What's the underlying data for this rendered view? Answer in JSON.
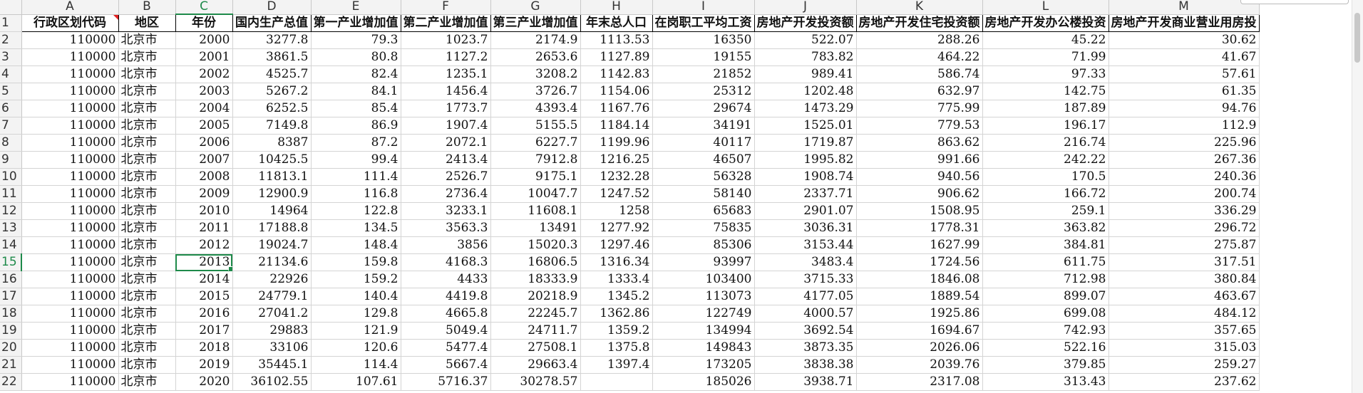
{
  "sheet": {
    "columns": [
      "A",
      "B",
      "C",
      "D",
      "E",
      "F",
      "G",
      "H",
      "I",
      "J",
      "K",
      "L",
      "M"
    ],
    "active_column": "C",
    "active_row": "15",
    "header_row": {
      "row_number": "1",
      "cells": [
        "行政区划代码",
        "地区",
        "年份",
        "国内生产总值",
        "第一产业增加值",
        "第二产业增加值",
        "第三产业增加值",
        "年末总人口",
        "在岗职工平均工资",
        "房地产开发投资额",
        "房地产开发住宅投资额",
        "房地产开发办公楼投资",
        "房地产开发商业营业用房投"
      ]
    },
    "rows": [
      {
        "n": "2",
        "cells": [
          "110000",
          "北京市",
          "2000",
          "3277.8",
          "79.3",
          "1023.7",
          "2174.9",
          "1113.53",
          "16350",
          "522.07",
          "288.26",
          "45.22",
          "30.62"
        ]
      },
      {
        "n": "3",
        "cells": [
          "110000",
          "北京市",
          "2001",
          "3861.5",
          "80.8",
          "1127.2",
          "2653.6",
          "1127.89",
          "19155",
          "783.82",
          "464.22",
          "71.99",
          "41.67"
        ]
      },
      {
        "n": "4",
        "cells": [
          "110000",
          "北京市",
          "2002",
          "4525.7",
          "82.4",
          "1235.1",
          "3208.2",
          "1142.83",
          "21852",
          "989.41",
          "586.74",
          "97.33",
          "57.61"
        ]
      },
      {
        "n": "5",
        "cells": [
          "110000",
          "北京市",
          "2003",
          "5267.2",
          "84.1",
          "1456.4",
          "3726.7",
          "1154.06",
          "25312",
          "1202.48",
          "632.97",
          "142.75",
          "61.35"
        ]
      },
      {
        "n": "6",
        "cells": [
          "110000",
          "北京市",
          "2004",
          "6252.5",
          "85.4",
          "1773.7",
          "4393.4",
          "1167.76",
          "29674",
          "1473.29",
          "775.99",
          "187.89",
          "94.76"
        ]
      },
      {
        "n": "7",
        "cells": [
          "110000",
          "北京市",
          "2005",
          "7149.8",
          "86.9",
          "1907.4",
          "5155.5",
          "1184.14",
          "34191",
          "1525.01",
          "779.53",
          "196.17",
          "112.9"
        ]
      },
      {
        "n": "8",
        "cells": [
          "110000",
          "北京市",
          "2006",
          "8387",
          "87.2",
          "2072.1",
          "6227.7",
          "1199.96",
          "40117",
          "1719.87",
          "863.62",
          "216.74",
          "225.96"
        ]
      },
      {
        "n": "9",
        "cells": [
          "110000",
          "北京市",
          "2007",
          "10425.5",
          "99.4",
          "2413.4",
          "7912.8",
          "1216.25",
          "46507",
          "1995.82",
          "991.66",
          "242.22",
          "267.36"
        ]
      },
      {
        "n": "10",
        "cells": [
          "110000",
          "北京市",
          "2008",
          "11813.1",
          "111.4",
          "2526.7",
          "9175.1",
          "1232.28",
          "56328",
          "1908.74",
          "940.56",
          "170.5",
          "240.36"
        ]
      },
      {
        "n": "11",
        "cells": [
          "110000",
          "北京市",
          "2009",
          "12900.9",
          "116.8",
          "2736.4",
          "10047.7",
          "1247.52",
          "58140",
          "2337.71",
          "906.62",
          "166.72",
          "200.74"
        ]
      },
      {
        "n": "12",
        "cells": [
          "110000",
          "北京市",
          "2010",
          "14964",
          "122.8",
          "3233.1",
          "11608.1",
          "1258",
          "65683",
          "2901.07",
          "1508.95",
          "259.1",
          "336.29"
        ]
      },
      {
        "n": "13",
        "cells": [
          "110000",
          "北京市",
          "2011",
          "17188.8",
          "134.5",
          "3563.3",
          "13491",
          "1277.92",
          "75835",
          "3036.31",
          "1778.31",
          "363.82",
          "296.72"
        ]
      },
      {
        "n": "14",
        "cells": [
          "110000",
          "北京市",
          "2012",
          "19024.7",
          "148.4",
          "3856",
          "15020.3",
          "1297.46",
          "85306",
          "3153.44",
          "1627.99",
          "384.81",
          "275.87"
        ]
      },
      {
        "n": "15",
        "cells": [
          "110000",
          "北京市",
          "2013",
          "21134.6",
          "159.8",
          "4168.3",
          "16806.5",
          "1316.34",
          "93997",
          "3483.4",
          "1724.56",
          "611.75",
          "317.51"
        ]
      },
      {
        "n": "16",
        "cells": [
          "110000",
          "北京市",
          "2014",
          "22926",
          "159.2",
          "4433",
          "18333.9",
          "1333.4",
          "103400",
          "3715.33",
          "1846.08",
          "712.98",
          "380.84"
        ]
      },
      {
        "n": "17",
        "cells": [
          "110000",
          "北京市",
          "2015",
          "24779.1",
          "140.4",
          "4419.8",
          "20218.9",
          "1345.2",
          "113073",
          "4177.05",
          "1889.54",
          "899.07",
          "463.67"
        ]
      },
      {
        "n": "18",
        "cells": [
          "110000",
          "北京市",
          "2016",
          "27041.2",
          "129.8",
          "4665.8",
          "22245.7",
          "1362.86",
          "122749",
          "4000.57",
          "1925.86",
          "699.08",
          "484.12"
        ]
      },
      {
        "n": "19",
        "cells": [
          "110000",
          "北京市",
          "2017",
          "29883",
          "121.9",
          "5049.4",
          "24711.7",
          "1359.2",
          "134994",
          "3692.54",
          "1694.67",
          "742.93",
          "357.65"
        ]
      },
      {
        "n": "20",
        "cells": [
          "110000",
          "北京市",
          "2018",
          "33106",
          "120.6",
          "5477.4",
          "27508.1",
          "1375.8",
          "149843",
          "3873.35",
          "2026.06",
          "522.16",
          "315.03"
        ]
      },
      {
        "n": "21",
        "cells": [
          "110000",
          "北京市",
          "2019",
          "35445.1",
          "114.4",
          "5667.4",
          "29663.4",
          "1397.4",
          "173205",
          "3838.38",
          "2039.76",
          "379.85",
          "259.27"
        ]
      },
      {
        "n": "22",
        "cells": [
          "110000",
          "北京市",
          "2020",
          "36102.55",
          "107.61",
          "5716.37",
          "30278.57",
          "",
          "185026",
          "3938.71",
          "2317.08",
          "313.43",
          "237.62"
        ]
      }
    ]
  }
}
